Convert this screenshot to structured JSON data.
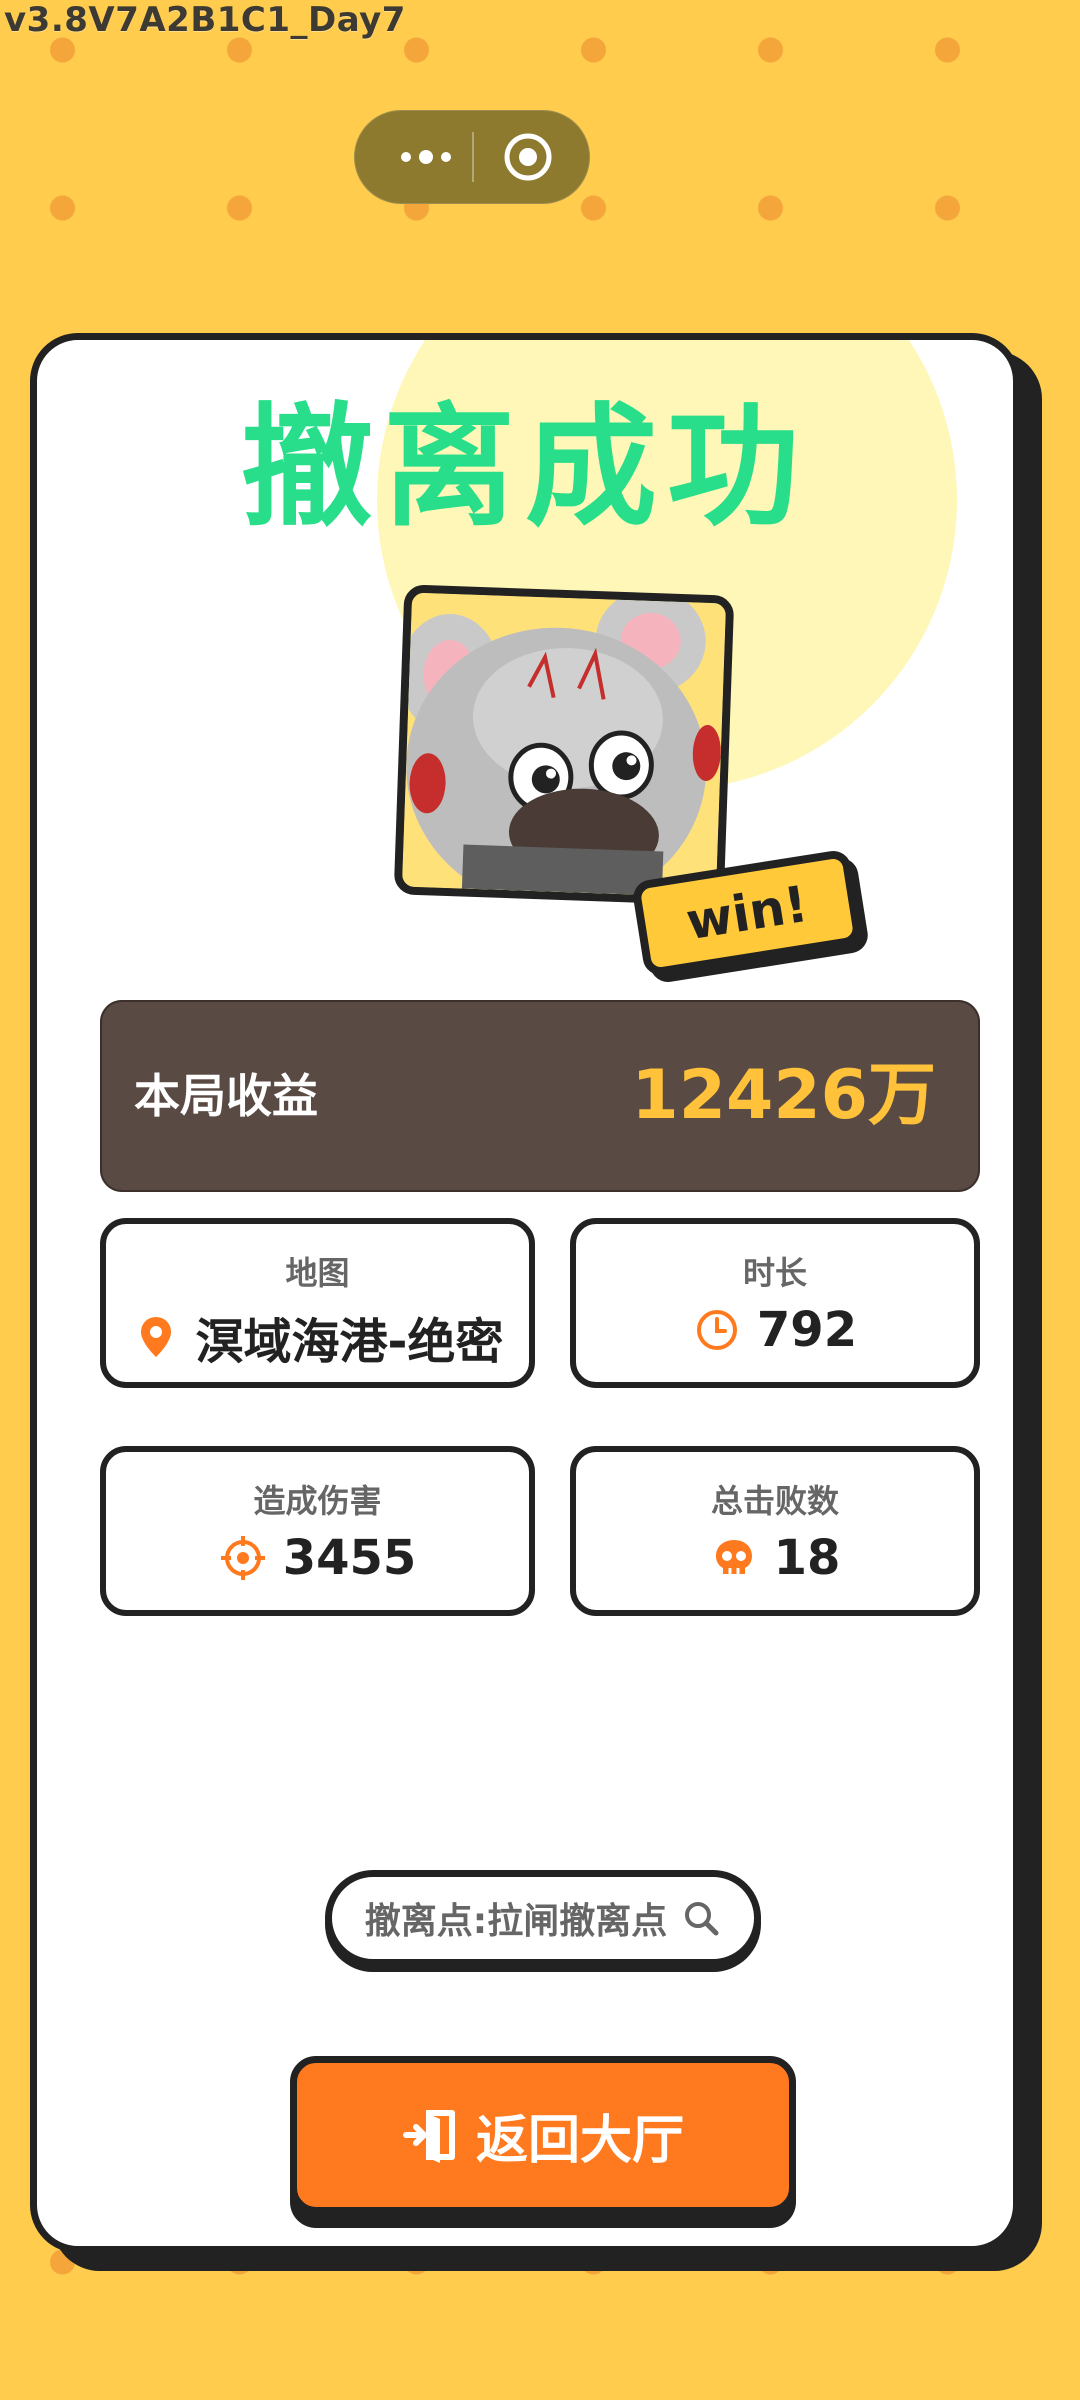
{
  "version_label": "v3.8V7A2B1C1_Day7",
  "capsule": {
    "more_icon": "more-dots-icon",
    "close_icon": "target-close-icon"
  },
  "result": {
    "title": "撤离成功",
    "win_badge": "win!",
    "income_label": "本局收益",
    "income_value": "12426万"
  },
  "stats": [
    {
      "label": "地图",
      "value": "溟域海港-绝密",
      "icon": "location-pin-icon"
    },
    {
      "label": "时长",
      "value": "792",
      "icon": "clock-icon"
    },
    {
      "label": "造成伤害",
      "value": "3455",
      "icon": "crosshair-icon"
    },
    {
      "label": "总击败数",
      "value": "18",
      "icon": "skull-icon"
    }
  ],
  "evac_point": {
    "text": "撤离点:拉闸撤离点",
    "icon": "search-icon"
  },
  "return_button": {
    "label": "返回大厅",
    "icon": "exit-door-icon"
  },
  "colors": {
    "background": "#ffcc4d",
    "dots": "#f4a63b",
    "title": "#28de8a",
    "income_panel": "#5a4a44",
    "income_value": "#ffc23a",
    "accent": "#ff7a1e",
    "outline": "#222222"
  }
}
